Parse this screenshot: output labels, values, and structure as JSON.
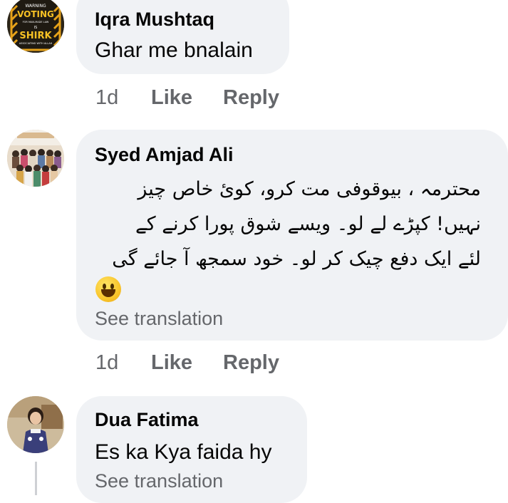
{
  "comments": [
    {
      "author": "Iqra Mushtaq",
      "text": "Ghar me bnalain",
      "avatar": {
        "type": "warning-sign",
        "lines": [
          "WARNING",
          "VOTING",
          "FOR MAN-MADE LAW",
          "IS",
          "SHIRK",
          "ASSOCIATING WITH ALLAH"
        ]
      },
      "time": "1d",
      "like_label": "Like",
      "reply_label": "Reply"
    },
    {
      "author": "Syed Amjad Ali",
      "text_lines": [
        "محترمہ ، بیوقوفی مت کرو، کوئ خاص چیز",
        "نہیں! کپڑے لے لو۔ ویسے شوق پورا کرنے کے",
        "لئے ایک دفع چیک کر لو۔ خود سمجھ آ جائے گی"
      ],
      "emoji": "grinning-face-icon",
      "see_translation": "See translation",
      "time": "1d",
      "like_label": "Like",
      "reply_label": "Reply"
    },
    {
      "author": "Dua Fatima",
      "text": "Es ka Kya faida hy",
      "see_translation": "See translation"
    }
  ],
  "colors": {
    "bubble": "#f0f2f5",
    "secondary_text": "#65676b",
    "primary_text": "#050505"
  }
}
